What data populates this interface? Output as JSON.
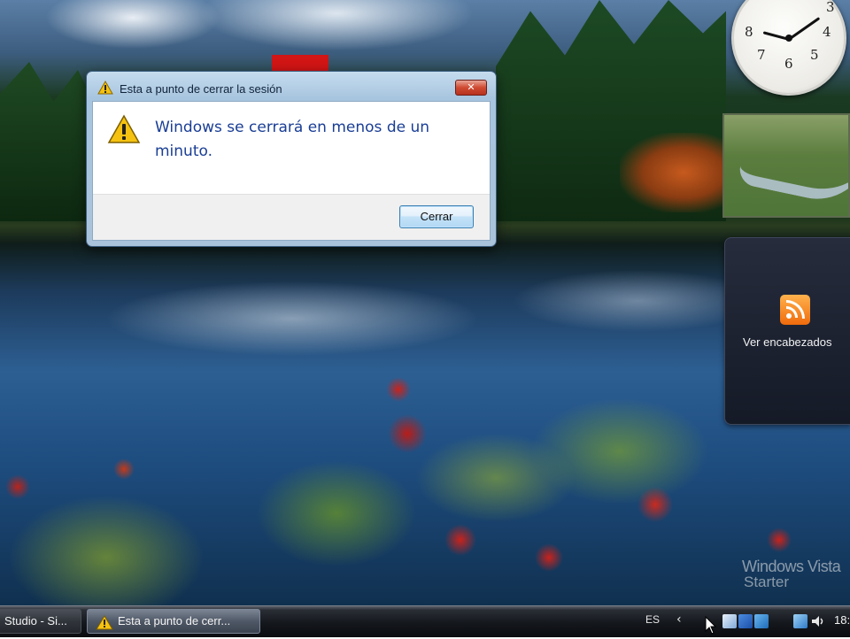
{
  "dialog": {
    "title": "Esta a punto de cerrar la sesión",
    "message": "Windows se cerrará en menos de un minuto.",
    "close_glyph": "✕",
    "button_label": "Cerrar",
    "icon": "warning-icon"
  },
  "gadgets": {
    "clock": {
      "numbers": [
        "8",
        "7",
        "6",
        "5",
        "4",
        "3"
      ],
      "hour_hand_direction": "8",
      "minute_hand_direction": "2"
    },
    "feed": {
      "icon": "rss-icon",
      "label": "Ver encabezados"
    }
  },
  "watermark": {
    "line1": "Windows Vista",
    "line2": "Starter"
  },
  "taskbar": {
    "buttons": [
      {
        "label": "Studio - Si...",
        "icon": ""
      },
      {
        "label": "Esta a punto de cerr...",
        "icon": "warning-icon"
      }
    ],
    "tray": {
      "language": "ES",
      "chevron": "‹",
      "time": "18:"
    }
  },
  "colors": {
    "message_text": "#1a3e95",
    "close_button": "#cf4a32",
    "warning": "#f5c211"
  }
}
